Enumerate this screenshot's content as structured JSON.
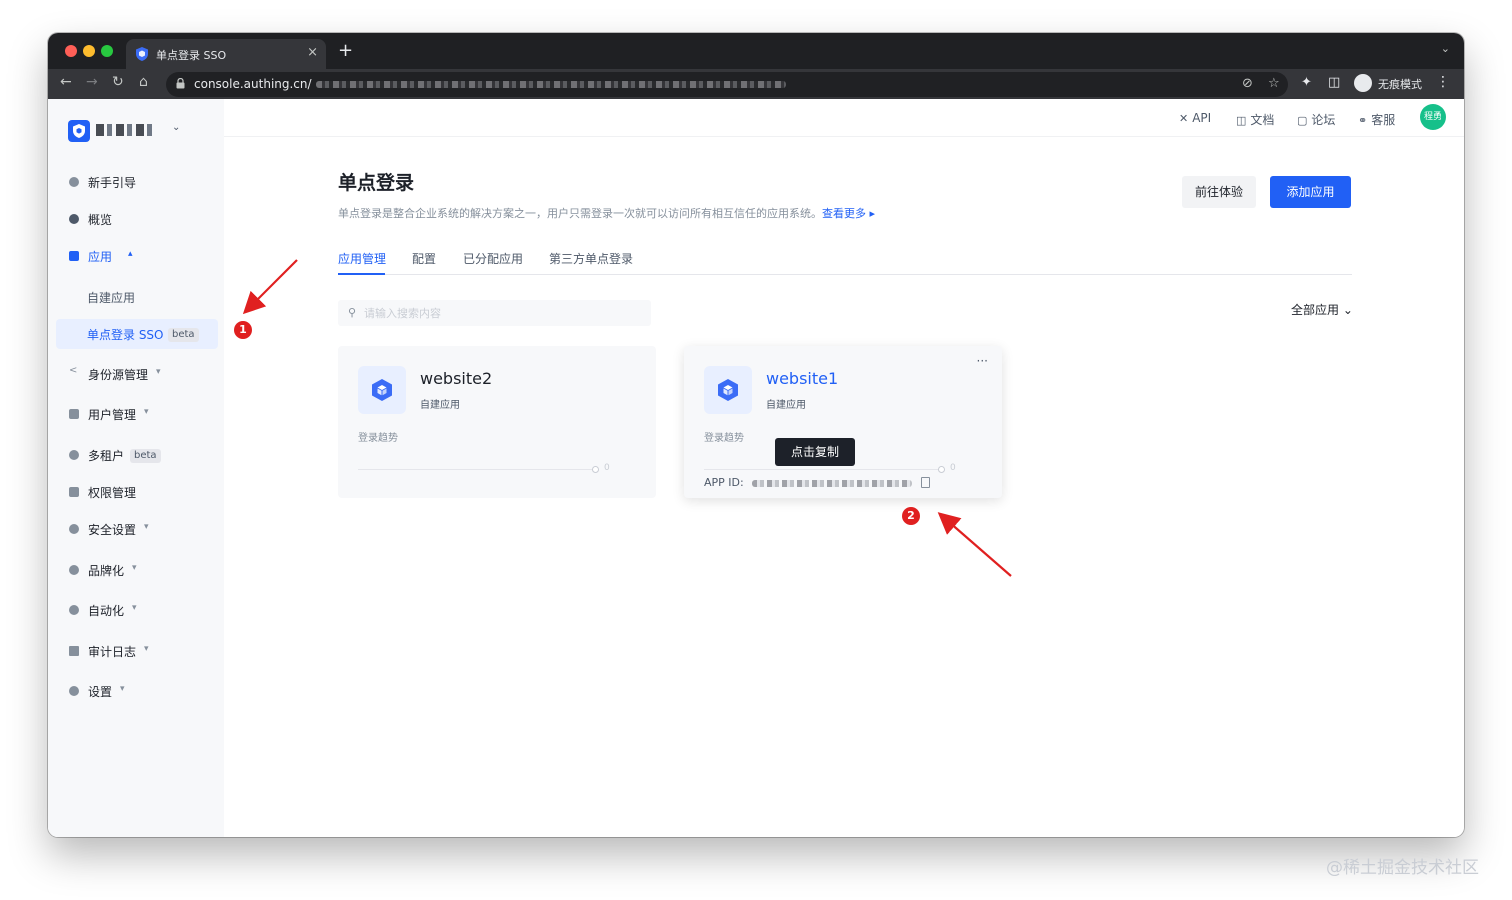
{
  "browser": {
    "tab_title": "单点登录 SSO",
    "tab_close": "×",
    "new_tab": "+",
    "url_host": "console.authing.cn/",
    "incognito_label": "无痕模式"
  },
  "sidebar": {
    "items": [
      {
        "label": "新手引导"
      },
      {
        "label": "概览"
      },
      {
        "label": "应用"
      },
      {
        "label": "自建应用"
      },
      {
        "label": "单点登录 SSO",
        "badge": "beta"
      },
      {
        "label": "身份源管理"
      },
      {
        "label": "用户管理"
      },
      {
        "label": "多租户",
        "badge": "beta"
      },
      {
        "label": "权限管理"
      },
      {
        "label": "安全设置"
      },
      {
        "label": "品牌化"
      },
      {
        "label": "自动化"
      },
      {
        "label": "审计日志"
      },
      {
        "label": "设置"
      }
    ]
  },
  "topbar": {
    "links": [
      "API",
      "文档",
      "论坛",
      "客服"
    ],
    "avatar_text": "程勇"
  },
  "page": {
    "title": "单点登录",
    "description": "单点登录是整合企业系统的解决方案之一，用户只需登录一次就可以访问所有相互信任的应用系统。",
    "more_link": "查看更多 ▸",
    "try_button": "前往体验",
    "add_button": "添加应用",
    "tabs": [
      "应用管理",
      "配置",
      "已分配应用",
      "第三方单点登录"
    ],
    "search_placeholder": "请输入搜索内容",
    "filter_label": "全部应用 ⌄"
  },
  "cards": [
    {
      "name": "website2",
      "type": "自建应用",
      "trend_label": "登录趋势",
      "trend_value": "0"
    },
    {
      "name": "website1",
      "type": "自建应用",
      "trend_label": "登录趋势",
      "trend_value": "0",
      "more": "···",
      "tooltip": "点击复制",
      "appid_label": "APP ID:"
    }
  ],
  "annotations": [
    "1",
    "2"
  ],
  "watermark": "@稀土掘金技术社区",
  "colors": {
    "accent": "#2160f5",
    "annotation": "#e02020",
    "avatar": "#16c08a"
  }
}
